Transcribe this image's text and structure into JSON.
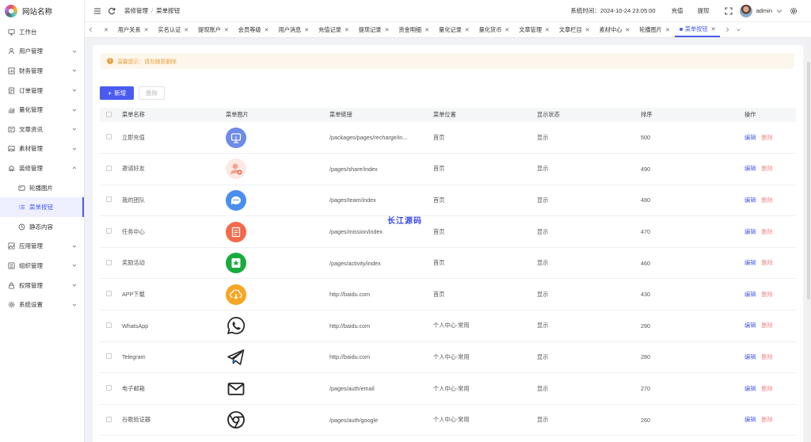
{
  "logo": {
    "text": "网站名称"
  },
  "sidebar": {
    "items": [
      {
        "label": "工作台",
        "icon": "monitor-icon",
        "arrow": false
      },
      {
        "label": "用户管理",
        "icon": "user-icon",
        "arrow": true
      },
      {
        "label": "财务管理",
        "icon": "finance-icon",
        "arrow": true
      },
      {
        "label": "订单管理",
        "icon": "order-icon",
        "arrow": true
      },
      {
        "label": "量化管理",
        "icon": "quant-icon",
        "arrow": true
      },
      {
        "label": "文章资讯",
        "icon": "article-icon",
        "arrow": true
      },
      {
        "label": "素材管理",
        "icon": "material-icon",
        "arrow": true
      },
      {
        "label": "装修管理",
        "icon": "decorate-icon",
        "arrow": true,
        "expanded": true
      },
      {
        "label": "轮播图片",
        "icon": "image-icon",
        "sub": true
      },
      {
        "label": "菜单按钮",
        "icon": "list-icon",
        "sub": true,
        "active": true
      },
      {
        "label": "静态内容",
        "icon": "clock-icon",
        "sub": true
      },
      {
        "label": "应用管理",
        "icon": "app-icon",
        "arrow": true
      },
      {
        "label": "组织管理",
        "icon": "org-icon",
        "arrow": true
      },
      {
        "label": "权限管理",
        "icon": "lock-icon",
        "arrow": true
      },
      {
        "label": "系统设置",
        "icon": "gear-icon",
        "arrow": true
      }
    ]
  },
  "header": {
    "breadcrumb": [
      "装修管理",
      "菜单按钮"
    ],
    "sys_time": "系统时间：2024-10-24 23:05:00",
    "recharge": "充值",
    "withdraw": "提现",
    "user": "admin"
  },
  "tabs": [
    {
      "label": "用户关系"
    },
    {
      "label": "实名认证"
    },
    {
      "label": "提现账户"
    },
    {
      "label": "会员等级"
    },
    {
      "label": "用户消息"
    },
    {
      "label": "充值记录"
    },
    {
      "label": "提现记录"
    },
    {
      "label": "资金明细"
    },
    {
      "label": "量化记录"
    },
    {
      "label": "量化货币"
    },
    {
      "label": "文章管理"
    },
    {
      "label": "文章栏目"
    },
    {
      "label": "素材中心"
    },
    {
      "label": "轮播图片"
    },
    {
      "label": "菜单按钮",
      "active": true
    }
  ],
  "alert": {
    "text": "温馨提示：请勿随意删除"
  },
  "buttons": {
    "add": "新增",
    "delete": "删除"
  },
  "table": {
    "headers": [
      "菜单名称",
      "菜单图片",
      "菜单链接",
      "菜单位置",
      "显示状态",
      "排序",
      "操作"
    ],
    "edit_label": "编辑",
    "delete_label": "删除",
    "rows": [
      {
        "name": "立即充值",
        "icon": "recharge-icon",
        "icon_color": "#6d8be8",
        "link": "/packages/pages/recharge/in...",
        "position": "首页",
        "status": "显示",
        "sort": "500"
      },
      {
        "name": "邀请好友",
        "icon": "invite-icon",
        "icon_color": "#f4a28c",
        "link": "/pages/share/index",
        "position": "首页",
        "status": "显示",
        "sort": "490"
      },
      {
        "name": "我的团队",
        "icon": "team-icon",
        "icon_color": "#4a8ef0",
        "link": "/pages/team/index",
        "position": "首页",
        "status": "显示",
        "sort": "480"
      },
      {
        "name": "任务中心",
        "icon": "task-icon",
        "icon_color": "#f26a4b",
        "link": "/pages/mission/index",
        "position": "首页",
        "status": "显示",
        "sort": "470"
      },
      {
        "name": "奖励活动",
        "icon": "reward-icon",
        "icon_color": "#1aab3f",
        "link": "/pages/activity/index",
        "position": "首页",
        "status": "显示",
        "sort": "460"
      },
      {
        "name": "APP下载",
        "icon": "download-icon",
        "icon_color": "#f5a623",
        "link": "http://baidu.com",
        "position": "首页",
        "status": "显示",
        "sort": "430"
      },
      {
        "name": "WhatsApp",
        "icon": "whatsapp-icon",
        "icon_color": "#222222",
        "link": "http://baidu.com",
        "position": "个人中心-常用",
        "status": "显示",
        "sort": "290"
      },
      {
        "name": "Telegram",
        "icon": "telegram-icon",
        "icon_color": "#222222",
        "link": "http://baidu.com",
        "position": "个人中心-常用",
        "status": "显示",
        "sort": "280"
      },
      {
        "name": "电子邮箱",
        "icon": "email-icon",
        "icon_color": "#222222",
        "link": "/pages/auth/email",
        "position": "个人中心-常用",
        "status": "显示",
        "sort": "270"
      },
      {
        "name": "谷歌验证器",
        "icon": "google-auth-icon",
        "icon_color": "#222222",
        "link": "/pages/auth/google",
        "position": "个人中心-常用",
        "status": "显示",
        "sort": "260"
      }
    ]
  },
  "watermark": "长江源码",
  "colors": {
    "primary": "#4a5cf0",
    "danger": "#f08c8c",
    "warning": "#e6a23c"
  }
}
